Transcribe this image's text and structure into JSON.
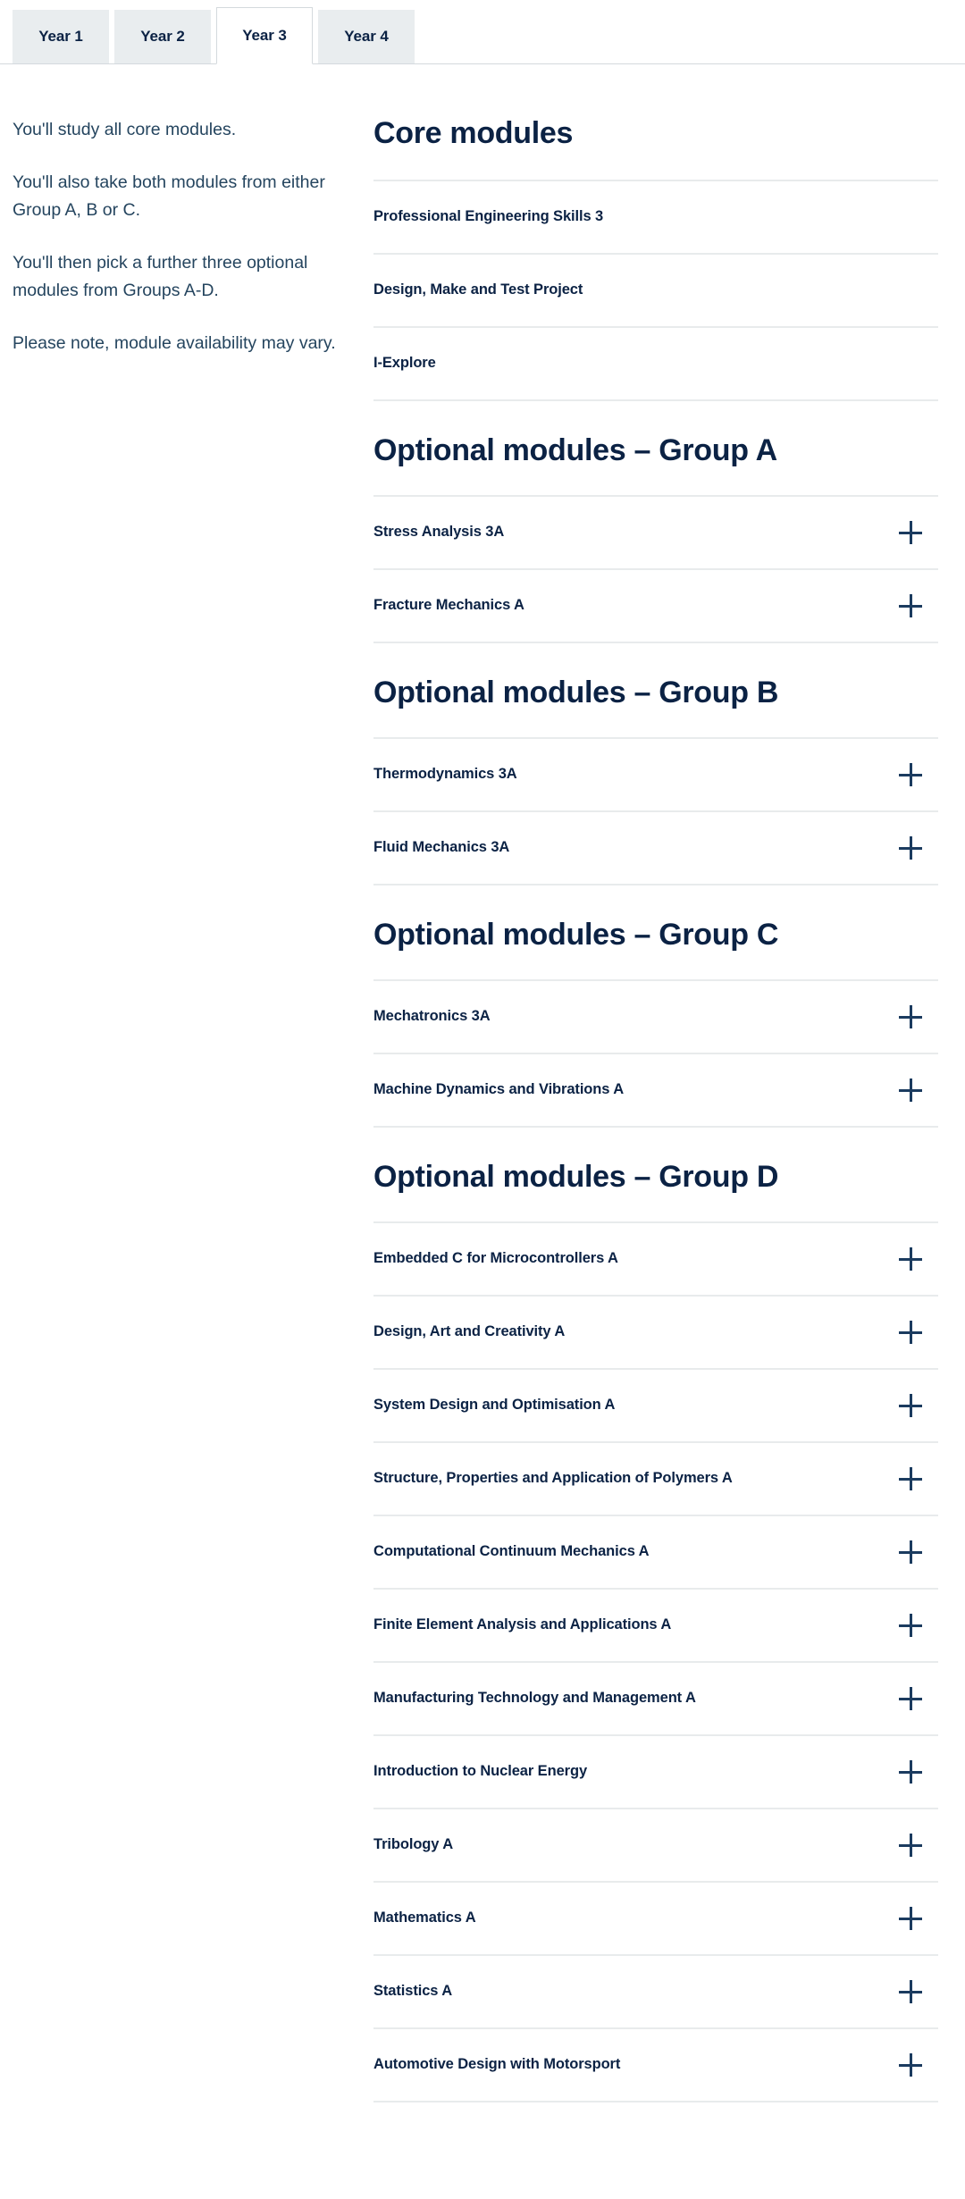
{
  "tabs": [
    {
      "label": "Year 1",
      "active": false
    },
    {
      "label": "Year 2",
      "active": false
    },
    {
      "label": "Year 3",
      "active": true
    },
    {
      "label": "Year 4",
      "active": false
    }
  ],
  "sidebar": {
    "paragraphs": [
      "You'll study all core modules.",
      "You'll also take both modules from either Group A, B or C.",
      "You'll then pick a further three optional modules from Groups A-D.",
      "Please note, module availability may vary."
    ]
  },
  "sections": [
    {
      "heading": "Core modules",
      "expandable": false,
      "modules": [
        "Professional Engineering Skills 3",
        "Design, Make and Test Project",
        "I-Explore"
      ]
    },
    {
      "heading": "Optional modules – Group A",
      "expandable": true,
      "modules": [
        "Stress Analysis 3A",
        "Fracture Mechanics A"
      ]
    },
    {
      "heading": "Optional modules – Group B",
      "expandable": true,
      "modules": [
        "Thermodynamics 3A",
        "Fluid Mechanics 3A"
      ]
    },
    {
      "heading": "Optional modules – Group C",
      "expandable": true,
      "modules": [
        "Mechatronics 3A",
        "Machine Dynamics and Vibrations A"
      ]
    },
    {
      "heading": "Optional modules – Group D",
      "expandable": true,
      "modules": [
        "Embedded C for Microcontrollers A",
        "Design, Art and Creativity A",
        "System Design and Optimisation A",
        "Structure, Properties and Application of Polymers A",
        "Computational Continuum Mechanics A",
        "Finite Element Analysis and Applications A",
        "Manufacturing Technology and Management A",
        "Introduction to Nuclear Energy",
        "Tribology A",
        "Mathematics A",
        "Statistics A",
        "Automotive Design with Motorsport"
      ]
    }
  ],
  "icons": {
    "expand": "plus-icon"
  },
  "colors": {
    "heading": "#0b2244",
    "body_text": "#25455f",
    "tab_inactive_bg": "#e9edef",
    "rule": "#e8ebec"
  }
}
